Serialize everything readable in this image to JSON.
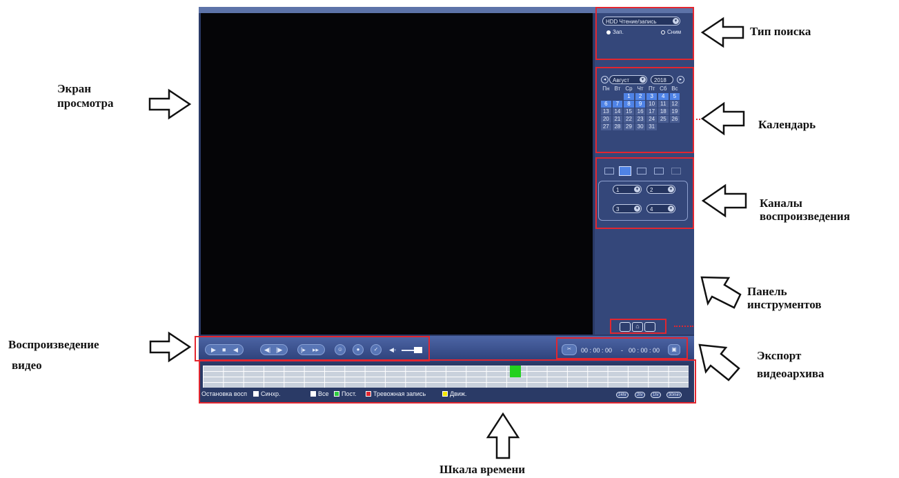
{
  "search_panel": {
    "type_select": "HDD Чтение/запись",
    "radio_record": "Зап.",
    "radio_snapshot": "Сним"
  },
  "calendar": {
    "month": "Август",
    "year": "2018",
    "weekdays": [
      "Пн",
      "Вт",
      "Ср",
      "Чт",
      "Пт",
      "Сб",
      "Вс"
    ],
    "leading_blank_days": 2,
    "days": [
      "1",
      "2",
      "3",
      "4",
      "5",
      "6",
      "7",
      "8",
      "9",
      "10",
      "11",
      "12",
      "13",
      "14",
      "15",
      "16",
      "17",
      "18",
      "19",
      "20",
      "21",
      "22",
      "23",
      "24",
      "25",
      "26",
      "27",
      "28",
      "29",
      "30",
      "31"
    ],
    "recorded_days": [
      "1",
      "2",
      "3",
      "4",
      "5",
      "6",
      "7",
      "8",
      "9"
    ],
    "record_highlight_color": "#4f83e6"
  },
  "channels": {
    "layout_icons": [
      "layout-1-icon",
      "layout-4-icon",
      "layout-9-icon",
      "layout-16-icon",
      "layout-custom-icon"
    ],
    "active_layout": "layout-4-icon",
    "selects": [
      "1",
      "2",
      "3",
      "4"
    ]
  },
  "tools": {
    "icons": [
      "clip-icon",
      "home-icon",
      "list-icon"
    ]
  },
  "playback": {
    "buttons": [
      "play-icon",
      "stop-icon",
      "reverse-play-icon",
      "prev-frame-icon",
      "next-frame-icon",
      "slow-icon",
      "fast-icon",
      "smart-search-icon",
      "record-icon",
      "mark-icon",
      "volume-icon"
    ],
    "clip_start": "00 : 00 : 00",
    "clip_separator": "-",
    "clip_end": "00 : 00 : 00",
    "clip_icon": "scissors-icon",
    "save_icon": "save-icon"
  },
  "timeline": {
    "stop_playback": "Остановка восп",
    "sync": "Синхр.",
    "legend": [
      {
        "label": "Все",
        "color": "#ffffff"
      },
      {
        "label": "Пост.",
        "color": "#2ecc40"
      },
      {
        "label": "Тревожная запись",
        "color": "#e3262f"
      },
      {
        "label": "Движ.",
        "color": "#f2e500"
      }
    ],
    "zoom_labels": [
      "24hr",
      "2hr",
      "1hr",
      "30min"
    ],
    "record_marker_color": "#22d11e"
  },
  "annotations": {
    "view_screen_line1": "Экран",
    "view_screen_line2": "просмотра",
    "search_type": "Тип поиска",
    "calendar": "Календарь",
    "channels_line1": "Каналы",
    "channels_line2": "воспроизведения",
    "tools_line1": "Панель",
    "tools_line2": "инструментов",
    "playback_line1": "Воспроизведение",
    "playback_line2": "видео",
    "export_line1": "Экспорт",
    "export_line2": "видеоархива",
    "timeline": "Шкала времени"
  },
  "colors": {
    "window_bg": "#2a3a66",
    "side_panel": "#34477a",
    "highlight_box": "#e3262f"
  }
}
